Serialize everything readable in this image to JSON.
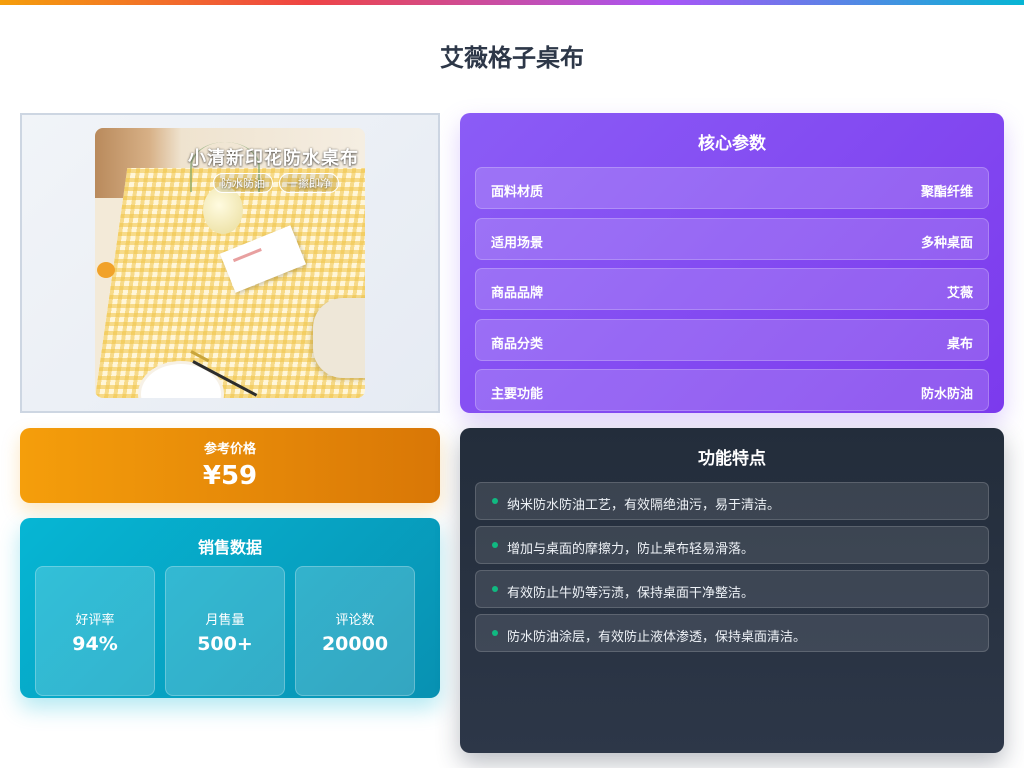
{
  "page": {
    "title": "艾薇格子桌布"
  },
  "product_image": {
    "headline": "小清新印花防水桌布",
    "tags": [
      "防水防油",
      "一擦即净"
    ]
  },
  "price": {
    "label": "参考价格",
    "value": "¥59"
  },
  "sales": {
    "title": "销售数据",
    "stats": [
      {
        "label": "好评率",
        "value": "94%"
      },
      {
        "label": "月售量",
        "value": "500+"
      },
      {
        "label": "评论数",
        "value": "20000"
      }
    ]
  },
  "specs": {
    "title": "核心参数",
    "rows": [
      {
        "name": "面料材质",
        "value": "聚酯纤维"
      },
      {
        "name": "适用场景",
        "value": "多种桌面"
      },
      {
        "name": "商品品牌",
        "value": "艾薇"
      },
      {
        "name": "商品分类",
        "value": "桌布"
      },
      {
        "name": "主要功能",
        "value": "防水防油"
      }
    ]
  },
  "features": {
    "title": "功能特点",
    "items": [
      "纳米防水防油工艺，有效隔绝油污，易于清洁。",
      "增加与桌面的摩擦力，防止桌布轻易滑落。",
      "有效防止牛奶等污渍，保持桌面干净整洁。",
      "防水防油涂层，有效防止液体渗透，保持桌面清洁。"
    ]
  },
  "colors": {
    "price_accent": "#f59e0b",
    "sales_accent": "#06b6d4",
    "specs_accent": "#8b5cf6",
    "features_bg": "#2d3748",
    "bullet": "#10b981"
  }
}
